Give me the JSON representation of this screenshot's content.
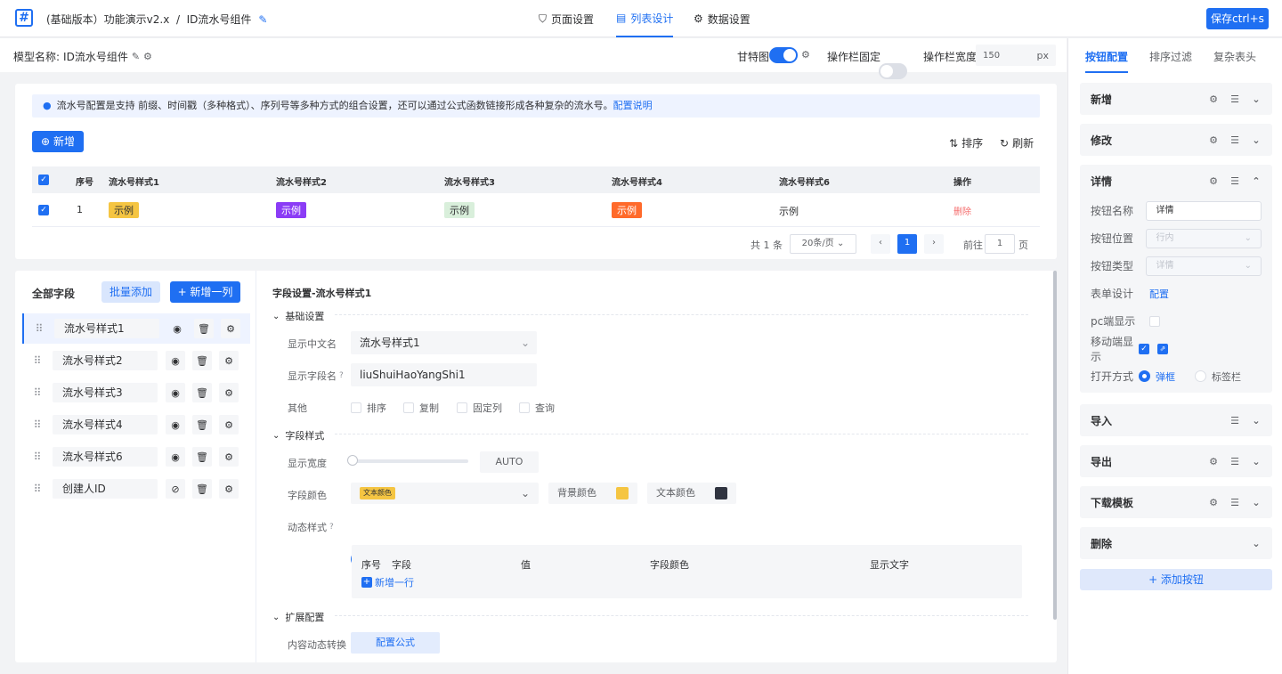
{
  "header": {
    "breadcrumb": "(基础版本）功能演示v2.x  /  ID流水号组件",
    "tabs": [
      {
        "label": "页面设置"
      },
      {
        "label": "列表设计"
      },
      {
        "label": "数据设置"
      }
    ],
    "save_label": "保存ctrl+s"
  },
  "subbar": {
    "model_label": "模型名称:",
    "model_name": "ID流水号组件",
    "gantt_label": "甘特图",
    "gantt_on": true,
    "fixed_label": "操作栏固定",
    "fixed_on": false,
    "width_label": "操作栏宽度",
    "width_value": "150",
    "width_unit": "px"
  },
  "info": {
    "text": "流水号配置是支持 前缀、时间戳（多种格式）、序列号等多种方式的组合设置，还可以通过公式函数链接形成各种复杂的流水号。",
    "link": "配置说明"
  },
  "toolbar": {
    "add_label": "新增",
    "sort_label": "排序",
    "refresh_label": "刷新"
  },
  "table": {
    "columns": [
      "序号",
      "流水号样式1",
      "流水号样式2",
      "流水号样式3",
      "流水号样式4",
      "流水号样式6",
      "操作"
    ],
    "rows": [
      {
        "index": "1",
        "c1": "示例",
        "c2": "示例",
        "c3": "示例",
        "c4": "示例",
        "c6": "示例",
        "action": "删除"
      }
    ]
  },
  "pager": {
    "total": "共 1 条",
    "page_size": "20条/页",
    "current": "1",
    "goto_label": "前往",
    "goto_value": "1",
    "page_suffix": "页"
  },
  "fields": {
    "title": "全部字段",
    "batch_add": "批量添加",
    "add_column": "+ 新增一列",
    "items": [
      {
        "label": "流水号样式1"
      },
      {
        "label": "流水号样式2"
      },
      {
        "label": "流水号样式3"
      },
      {
        "label": "流水号样式4"
      },
      {
        "label": "流水号样式6"
      },
      {
        "label": "创建人ID"
      }
    ]
  },
  "settings": {
    "title": "字段设置-流水号样式1",
    "basic": {
      "section": "基础设置",
      "cn_label": "显示中文名",
      "cn_value": "流水号样式1",
      "field_label": "显示字段名",
      "field_value": "liuShuiHaoYangShi1",
      "other_label": "其他",
      "options": [
        "排序",
        "复制",
        "固定列",
        "查询"
      ]
    },
    "style": {
      "section": "字段样式",
      "width_label": "显示宽度",
      "width_value": "AUTO",
      "color_label": "字段颜色",
      "color_tag": "文本颜色",
      "bg_label": "背景颜色",
      "bg_color": "#f5c542",
      "text_label": "文本颜色",
      "text_color": "#303440",
      "dynamic_label": "动态样式",
      "dynamic_on": true,
      "dyn_columns": [
        "序号",
        "字段",
        "值",
        "字段颜色",
        "显示文字"
      ],
      "dyn_add": "新增一行"
    },
    "ext": {
      "section": "扩展配置",
      "convert_label": "内容动态转换",
      "formula_btn": "配置公式"
    }
  },
  "right": {
    "tabs": [
      {
        "label": "按钮配置"
      },
      {
        "label": "排序过滤"
      },
      {
        "label": "复杂表头"
      }
    ],
    "buttons": [
      {
        "name": "新增"
      },
      {
        "name": "修改"
      },
      {
        "name": "详情"
      },
      {
        "name": "导入"
      },
      {
        "name": "导出"
      },
      {
        "name": "下载模板"
      },
      {
        "name": "删除"
      }
    ],
    "detail": {
      "name_label": "按钮名称",
      "name_value": "详情",
      "pos_label": "按钮位置",
      "pos_value": "行内",
      "type_label": "按钮类型",
      "type_value": "详情",
      "form_label": "表单设计",
      "form_link": "配置",
      "pc_label": "pc端显示",
      "mobile_label": "移动端显示",
      "open_label": "打开方式",
      "open_options": [
        "弹框",
        "标签栏"
      ]
    },
    "add_button": "+ 添加按钮"
  },
  "colors": {
    "primary": "#1f6ff2",
    "danger": "#f56c6c",
    "tag_yellow": "#f5c542",
    "tag_purple": "#8b3cf6",
    "tag_green": "#d9efdb",
    "tag_orange": "#ff6a2b"
  }
}
